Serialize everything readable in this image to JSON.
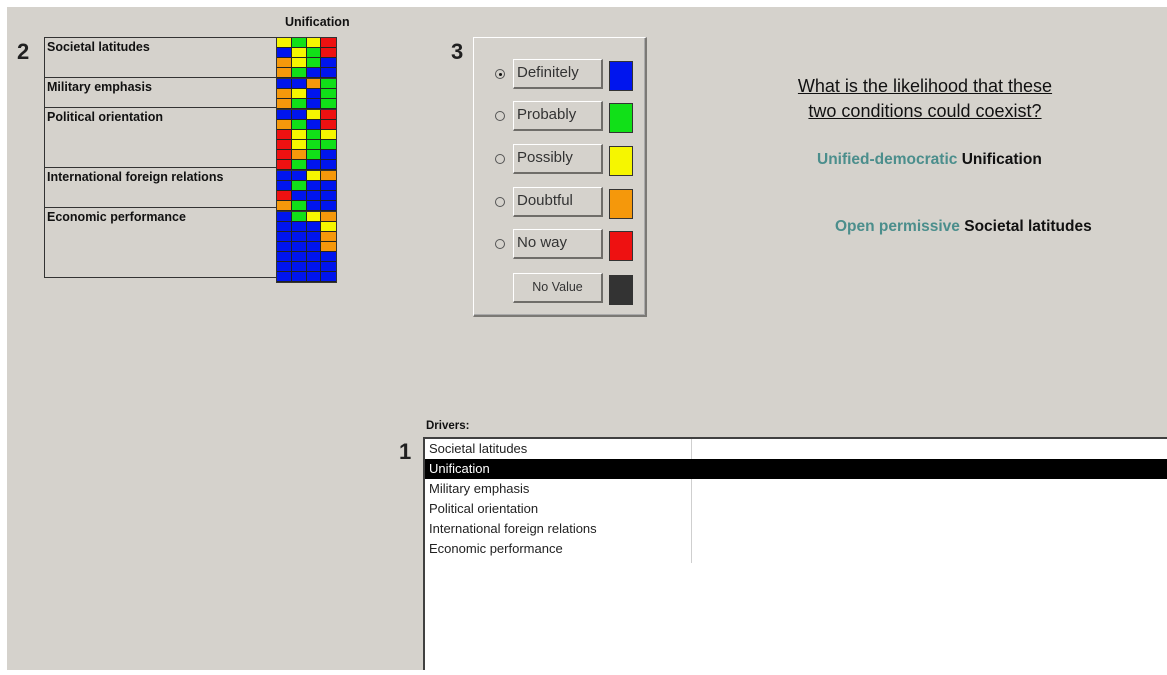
{
  "colors": {
    "definitely": "#0015ee",
    "probably": "#11e018",
    "possibly": "#f6f600",
    "doubtful": "#f5980b",
    "no_way": "#ee1111",
    "no_value": "#333333",
    "teal_text": "#4b8e8c"
  },
  "section_numbers": {
    "grid": "2",
    "options": "3",
    "drivers": "1"
  },
  "grid": {
    "column_header": "Unification",
    "rows": [
      {
        "label": "Societal latitudes",
        "cells": [
          [
            "Y",
            "G",
            "Y",
            "R"
          ],
          [
            "B",
            "Y",
            "G",
            "R"
          ],
          [
            "O",
            "Y",
            "G",
            "B"
          ],
          [
            "O",
            "G",
            "B",
            "B"
          ]
        ]
      },
      {
        "label": "Military emphasis",
        "cells": [
          [
            "B",
            "B",
            "O",
            "G"
          ],
          [
            "O",
            "Y",
            "B",
            "G"
          ],
          [
            "O",
            "G",
            "B",
            "G"
          ]
        ]
      },
      {
        "label": "Political orientation",
        "cells": [
          [
            "B",
            "B",
            "Y",
            "R"
          ],
          [
            "O",
            "G",
            "B",
            "R"
          ],
          [
            "R",
            "Y",
            "G",
            "Y"
          ],
          [
            "R",
            "Y",
            "G",
            "G"
          ],
          [
            "R",
            "O",
            "G",
            "B"
          ],
          [
            "R",
            "G",
            "B",
            "B"
          ]
        ]
      },
      {
        "label": "International foreign relations",
        "cells": [
          [
            "B",
            "B",
            "Y",
            "O"
          ],
          [
            "B",
            "G",
            "B",
            "B"
          ],
          [
            "R",
            "B",
            "B",
            "B"
          ],
          [
            "O",
            "G",
            "B",
            "B"
          ]
        ]
      },
      {
        "label": "Economic performance",
        "cells": [
          [
            "B",
            "G",
            "Y",
            "O"
          ],
          [
            "B",
            "B",
            "B",
            "Y"
          ],
          [
            "B",
            "B",
            "B",
            "O"
          ],
          [
            "B",
            "B",
            "B",
            "O"
          ],
          [
            "B",
            "B",
            "B",
            "B"
          ],
          [
            "B",
            "B",
            "B",
            "B"
          ],
          [
            "B",
            "B",
            "B",
            "B"
          ]
        ]
      }
    ]
  },
  "options": [
    {
      "key": "definitely",
      "label": "Definitely",
      "checked": true,
      "radio": true
    },
    {
      "key": "probably",
      "label": "Probably",
      "checked": false,
      "radio": true
    },
    {
      "key": "possibly",
      "label": "Possibly",
      "checked": false,
      "radio": true
    },
    {
      "key": "doubtful",
      "label": "Doubtful",
      "checked": false,
      "radio": true
    },
    {
      "key": "no_way",
      "label": "No way",
      "checked": false,
      "radio": true
    },
    {
      "key": "no_value",
      "label": "No Value",
      "checked": false,
      "radio": false
    }
  ],
  "question": {
    "line1": "What is the likelihood that these",
    "line2": "two conditions could coexist?"
  },
  "conditions": [
    {
      "state": "Unified-democratic",
      "driver": "Unification"
    },
    {
      "state": "Open permissive",
      "driver": "Societal latitudes"
    }
  ],
  "drivers": {
    "label": "Drivers:",
    "items": [
      "Societal latitudes",
      "Unification",
      "Military emphasis",
      "Political orientation",
      "International foreign relations",
      "Economic performance"
    ],
    "selected_index": 1
  }
}
